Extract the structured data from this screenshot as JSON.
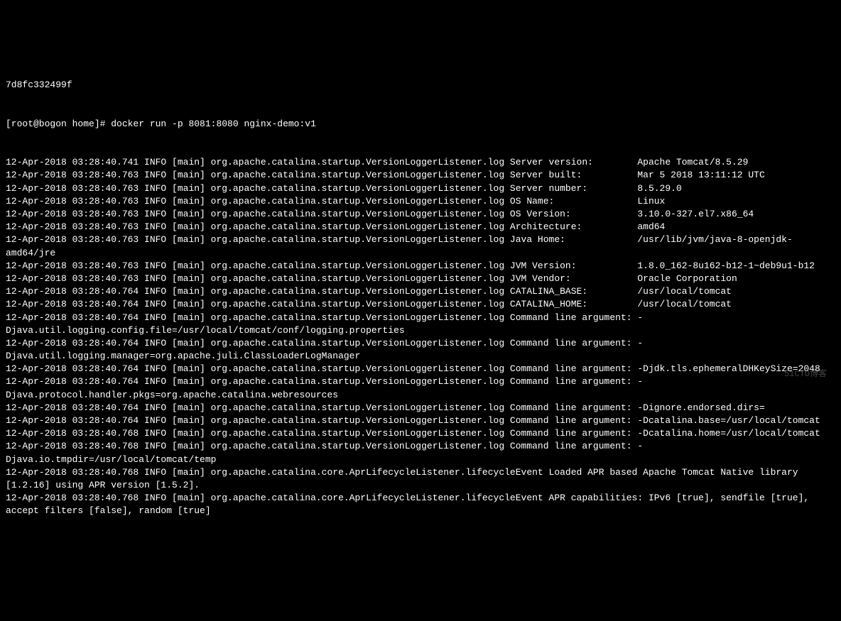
{
  "hash": "7d8fc332499f",
  "prompt": "[root@bogon home]# docker run -p 8081:8080 nginx-demo:v1",
  "lines": [
    "12-Apr-2018 03:28:40.741 INFO [main] org.apache.catalina.startup.VersionLoggerListener.log Server version:        Apache Tomcat/8.5.29",
    "12-Apr-2018 03:28:40.763 INFO [main] org.apache.catalina.startup.VersionLoggerListener.log Server built:          Mar 5 2018 13:11:12 UTC",
    "12-Apr-2018 03:28:40.763 INFO [main] org.apache.catalina.startup.VersionLoggerListener.log Server number:         8.5.29.0",
    "12-Apr-2018 03:28:40.763 INFO [main] org.apache.catalina.startup.VersionLoggerListener.log OS Name:               Linux",
    "12-Apr-2018 03:28:40.763 INFO [main] org.apache.catalina.startup.VersionLoggerListener.log OS Version:            3.10.0-327.el7.x86_64",
    "12-Apr-2018 03:28:40.763 INFO [main] org.apache.catalina.startup.VersionLoggerListener.log Architecture:          amd64",
    "12-Apr-2018 03:28:40.763 INFO [main] org.apache.catalina.startup.VersionLoggerListener.log Java Home:             /usr/lib/jvm/java-8-openjdk-amd64/jre",
    "12-Apr-2018 03:28:40.763 INFO [main] org.apache.catalina.startup.VersionLoggerListener.log JVM Version:           1.8.0_162-8u162-b12-1~deb9u1-b12",
    "12-Apr-2018 03:28:40.763 INFO [main] org.apache.catalina.startup.VersionLoggerListener.log JVM Vendor:            Oracle Corporation",
    "12-Apr-2018 03:28:40.764 INFO [main] org.apache.catalina.startup.VersionLoggerListener.log CATALINA_BASE:         /usr/local/tomcat",
    "12-Apr-2018 03:28:40.764 INFO [main] org.apache.catalina.startup.VersionLoggerListener.log CATALINA_HOME:         /usr/local/tomcat",
    "12-Apr-2018 03:28:40.764 INFO [main] org.apache.catalina.startup.VersionLoggerListener.log Command line argument: -Djava.util.logging.config.file=/usr/local/tomcat/conf/logging.properties",
    "12-Apr-2018 03:28:40.764 INFO [main] org.apache.catalina.startup.VersionLoggerListener.log Command line argument: -Djava.util.logging.manager=org.apache.juli.ClassLoaderLogManager",
    "12-Apr-2018 03:28:40.764 INFO [main] org.apache.catalina.startup.VersionLoggerListener.log Command line argument: -Djdk.tls.ephemeralDHKeySize=2048",
    "12-Apr-2018 03:28:40.764 INFO [main] org.apache.catalina.startup.VersionLoggerListener.log Command line argument: -Djava.protocol.handler.pkgs=org.apache.catalina.webresources",
    "12-Apr-2018 03:28:40.764 INFO [main] org.apache.catalina.startup.VersionLoggerListener.log Command line argument: -Dignore.endorsed.dirs=",
    "12-Apr-2018 03:28:40.764 INFO [main] org.apache.catalina.startup.VersionLoggerListener.log Command line argument: -Dcatalina.base=/usr/local/tomcat",
    "12-Apr-2018 03:28:40.768 INFO [main] org.apache.catalina.startup.VersionLoggerListener.log Command line argument: -Dcatalina.home=/usr/local/tomcat",
    "12-Apr-2018 03:28:40.768 INFO [main] org.apache.catalina.startup.VersionLoggerListener.log Command line argument: -Djava.io.tmpdir=/usr/local/tomcat/temp",
    "12-Apr-2018 03:28:40.768 INFO [main] org.apache.catalina.core.AprLifecycleListener.lifecycleEvent Loaded APR based Apache Tomcat Native library [1.2.16] using APR version [1.5.2].",
    "12-Apr-2018 03:28:40.768 INFO [main] org.apache.catalina.core.AprLifecycleListener.lifecycleEvent APR capabilities: IPv6 [true], sendfile [true], accept filters [false], random [true]"
  ],
  "watermark": "51CTO博客"
}
